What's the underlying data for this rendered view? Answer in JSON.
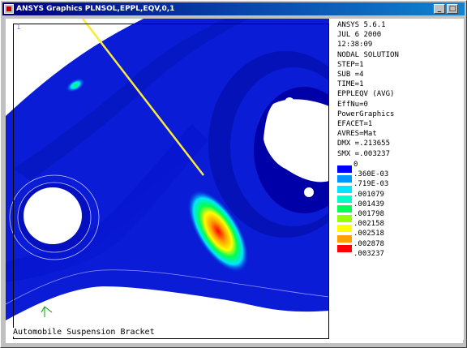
{
  "window": {
    "title": "ANSYS Graphics   PLNSOL,EPPL,EQV,0,1",
    "buttons": {
      "minimize": "_",
      "maximize": "□"
    }
  },
  "graphics": {
    "window_number": "1",
    "caption": "Automobile Suspension Bracket"
  },
  "info": {
    "lines": [
      "ANSYS 5.6.1",
      "JUL  6 2000",
      "12:38:09",
      "NODAL SOLUTION",
      "STEP=1",
      "SUB =4",
      "TIME=1",
      "EPPLEQV   (AVG)",
      "EffNu=0",
      "PowerGraphics",
      "EFACET=1",
      "AVRES=Mat",
      "DMX =.213655",
      "SMX =.003237"
    ]
  },
  "contour_legend": [
    {
      "value": "0",
      "color": "#0000ff"
    },
    {
      "value": ".360E-03",
      "color": "#0096ff"
    },
    {
      "value": ".719E-03",
      "color": "#00e6ff"
    },
    {
      "value": ".001079",
      "color": "#00ffc8"
    },
    {
      "value": ".001439",
      "color": "#00ff50"
    },
    {
      "value": ".001798",
      "color": "#96ff00"
    },
    {
      "value": ".002158",
      "color": "#ffff00"
    },
    {
      "value": ".002518",
      "color": "#ffa000"
    },
    {
      "value": ".002878",
      "color": "#ff0000"
    },
    {
      "value": ".003237",
      "color": "#ffffff"
    }
  ],
  "colors": {
    "model_main": "#0a1cd6",
    "model_dark": "#0000a8",
    "pointer_line": "#f8ea3c",
    "title_bar": "#000080"
  }
}
